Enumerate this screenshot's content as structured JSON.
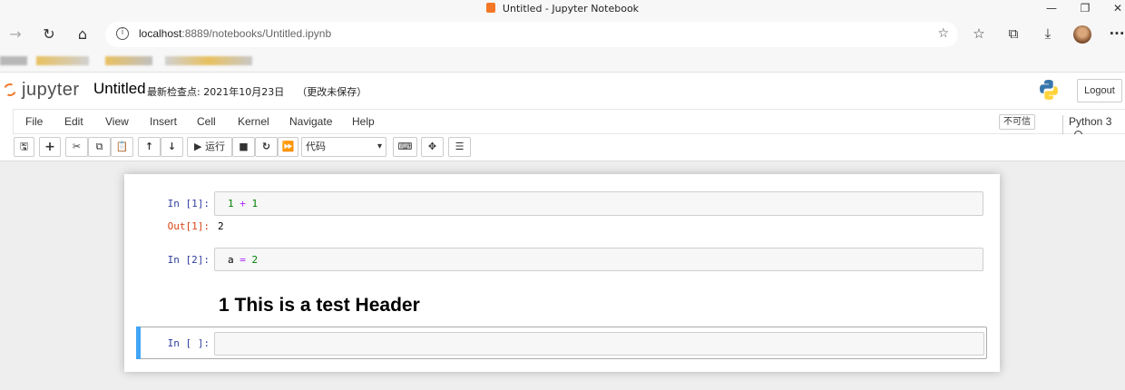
{
  "window": {
    "title": "Untitled - Jupyter Notebook",
    "controls": [
      "—",
      "❐",
      "✕"
    ]
  },
  "browser": {
    "url_host": "localhost",
    "url_path": ":8889/notebooks/Untitled.ipynb",
    "more_label": "···"
  },
  "jupyter": {
    "logo_text": "jupyter",
    "notebook_name": "Untitled",
    "checkpoint": "最新检查点: 2021年10月23日",
    "unsaved": "（更改未保存）",
    "logout_label": "Logout"
  },
  "menubar": {
    "items": [
      "File",
      "Edit",
      "View",
      "Insert",
      "Cell",
      "Kernel",
      "Navigate",
      "Help"
    ],
    "trust_label": "不可信",
    "kernel_name": "Python 3"
  },
  "toolbar": {
    "run_label": "▶ 运行",
    "cell_type": "代码"
  },
  "cells": [
    {
      "prompt": "In  [1]:",
      "code_a": "1",
      "code_op": " + ",
      "code_b": "1"
    },
    {
      "out_prompt": "Out[1]:",
      "output": "2"
    },
    {
      "prompt": "In  [2]:",
      "code_a": "a",
      "code_op": " = ",
      "code_b": "2"
    },
    {
      "heading": "1  This is a test Header"
    },
    {
      "prompt": "In  [ ]:"
    }
  ],
  "colors": {
    "jupyter_orange": "#f37726",
    "prompt_in": "#303f9f",
    "prompt_out": "#d84315",
    "selected_cell": "#42a5f5"
  }
}
